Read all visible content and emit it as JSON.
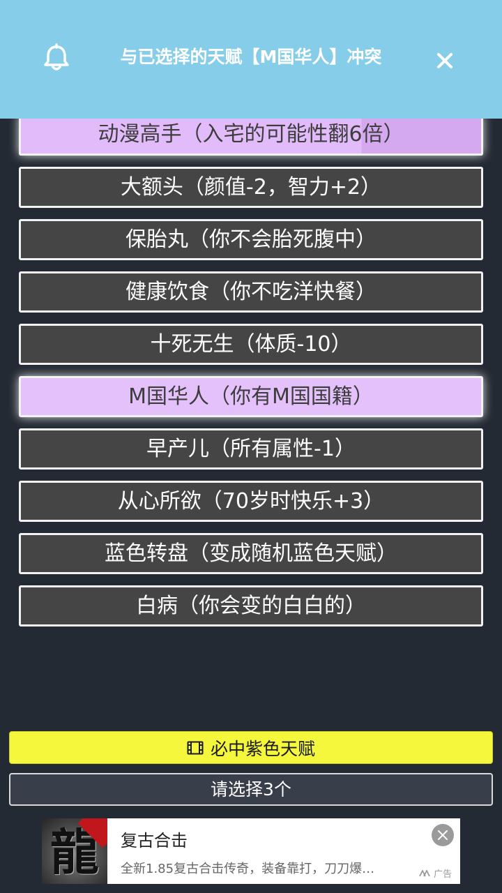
{
  "toast": {
    "message": "与已选择的天赋【M国华人】冲突",
    "icon": "bell-icon",
    "close_icon": "close-icon",
    "background": "#86cdea"
  },
  "talents": [
    {
      "label": "动漫高手（入宅的可能性翻6倍）",
      "selected": true
    },
    {
      "label": "大额头（颜值-2，智力+2）",
      "selected": false
    },
    {
      "label": "保胎丸（你不会胎死腹中）",
      "selected": false
    },
    {
      "label": "健康饮食（你不吃洋快餐）",
      "selected": false
    },
    {
      "label": "十死无生（体质-10）",
      "selected": false
    },
    {
      "label": "M国华人（你有M国国籍）",
      "selected": true
    },
    {
      "label": "早产儿（所有属性-1）",
      "selected": false
    },
    {
      "label": "从心所欲（70岁时快乐+3）",
      "selected": false
    },
    {
      "label": "蓝色转盘（变成随机蓝色天赋）",
      "selected": false
    },
    {
      "label": "白病（你会变的白白的）",
      "selected": false
    }
  ],
  "colors": {
    "background": "#232a33",
    "talent_default": "#454545",
    "talent_selected": "#e4c1fb",
    "purple_button": "#f4f73c"
  },
  "actions": {
    "purple_label": "必中紫色天赋",
    "purple_icon": "film-icon",
    "confirm_label": "请选择3个"
  },
  "ad": {
    "thumb_text": "龍",
    "title": "复古合击",
    "description": "全新1.85复古合击传奇，装备靠打，刀刀爆…",
    "tag": "广告",
    "close_icon": "close-icon"
  }
}
